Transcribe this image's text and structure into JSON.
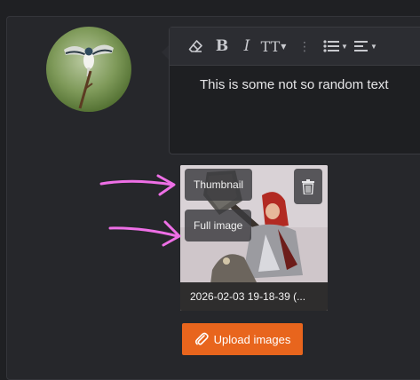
{
  "editor": {
    "toolbar": {
      "bold_label": "B",
      "italic_label": "I",
      "text_style_label": "TT",
      "more_label": "⋮"
    },
    "content": "This is some not so random text"
  },
  "attachment": {
    "thumbnail_label": "Thumbnail",
    "full_image_label": "Full image",
    "caption": "2026-02-03 19-18-39 (..."
  },
  "upload": {
    "label": "Upload images"
  },
  "colors": {
    "accent": "#e8651d",
    "annotation_arrow": "#ee6fe6",
    "background": "#1f2023",
    "panel": "#26272b"
  }
}
